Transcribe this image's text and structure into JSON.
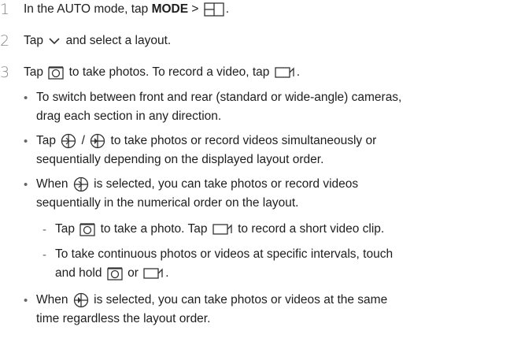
{
  "steps": [
    {
      "number": "1",
      "text_a": "In the AUTO mode, tap ",
      "bold": "MODE",
      "text_b": " > ",
      "text_c": "."
    },
    {
      "number": "2",
      "text_a": "Tap ",
      "text_b": " and select a layout."
    },
    {
      "number": "3",
      "text_a": "Tap ",
      "text_b": " to take photos. To record a video, tap ",
      "text_c": "."
    }
  ],
  "bullets": [
    {
      "line1": "To switch between front and rear (standard or wide-angle) cameras,",
      "line2": "drag each section in any direction."
    },
    {
      "line1_a": "Tap ",
      "line1_sep": " / ",
      "line1_b": " to take photos or record videos simultaneously or",
      "line2": "sequentially depending on the displayed layout order."
    },
    {
      "line1_a": "When ",
      "line1_b": " is selected, you can take photos or record videos",
      "line2": "sequentially in the numerical order on the layout."
    },
    {
      "line1_a": "When ",
      "line1_b": " is selected, you can take photos or videos at the same",
      "line2": "time regardless the layout order."
    }
  ],
  "subitems": [
    {
      "text_a": "Tap ",
      "text_b": " to take a photo. Tap ",
      "text_c": " to record a short video clip."
    },
    {
      "line1": "To take continuous photos or videos at specific intervals, touch",
      "line2_a": "and hold ",
      "line2_b": " or ",
      "line2_c": "."
    }
  ],
  "icons": {
    "layout": "layout-grid-icon",
    "chevron": "chevron-down-icon",
    "camera": "camera-shutter-icon",
    "video": "video-record-icon",
    "sequential": "sequential-shot-icon",
    "simultaneous": "simultaneous-shot-icon"
  },
  "colors": {
    "text": "#1e1e1e",
    "number": "#8a8a8a"
  }
}
